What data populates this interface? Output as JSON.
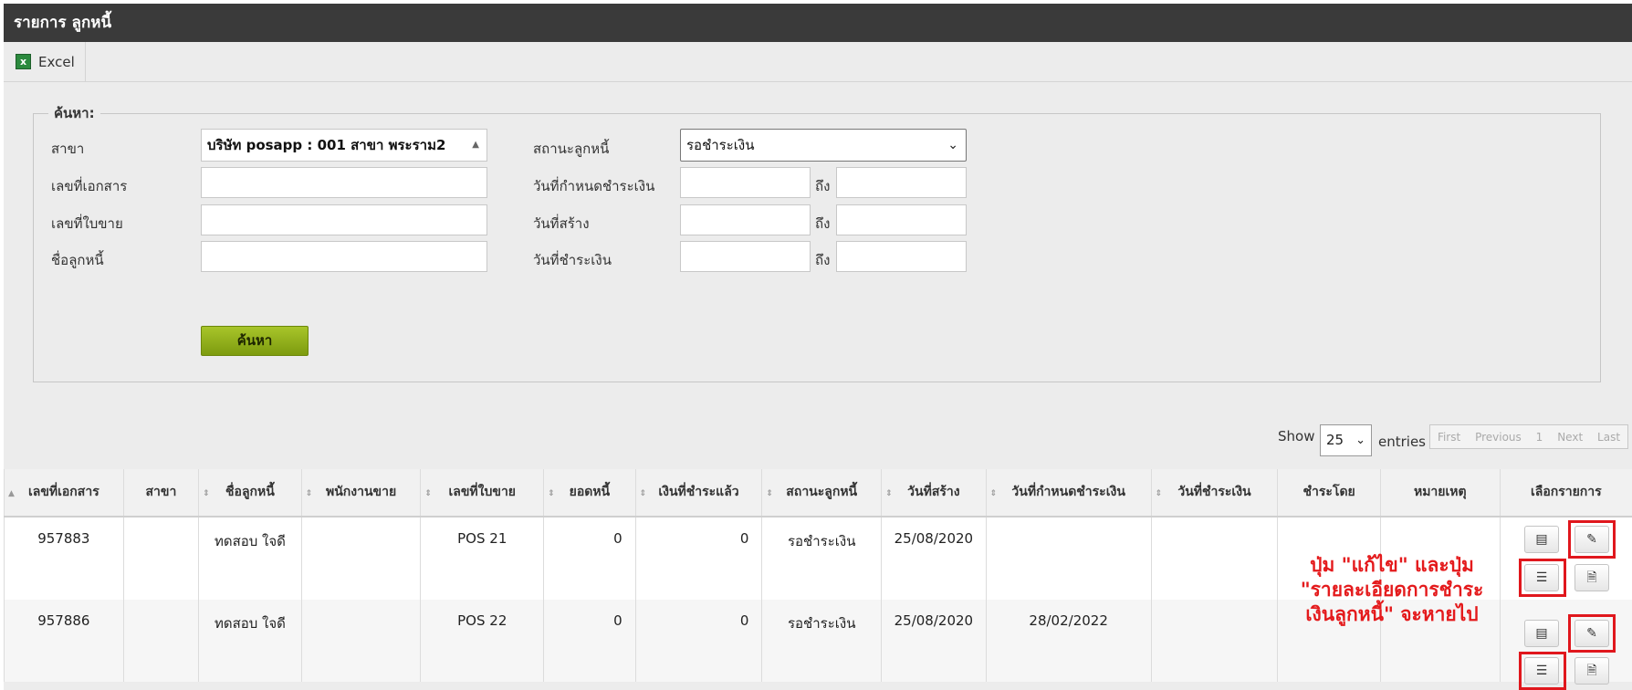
{
  "window": {
    "title": "รายการ ลูกหนี้"
  },
  "toolbar": {
    "excel_label": "Excel"
  },
  "search": {
    "legend": "ค้นหา:",
    "branch_label": "สาขา",
    "branch_value": "บริษัท posapp : 001 สาขา พระราม2",
    "doc_no_label": "เลขที่เอกสาร",
    "invoice_no_label": "เลขที่ใบขาย",
    "debtor_name_label": "ชื่อลูกหนี้",
    "status_label": "สถานะลูกหนี้",
    "status_value": "รอชำระเงิน",
    "due_date_label": "วันที่กำหนดชำระเงิน",
    "created_date_label": "วันที่สร้าง",
    "paid_date_label": "วันที่ชำระเงิน",
    "to_label": "ถึง",
    "button_label": "ค้นหา"
  },
  "paging": {
    "show_label": "Show",
    "page_size": "25",
    "entries_label": "entries",
    "first": "First",
    "previous": "Previous",
    "page": "1",
    "next": "Next",
    "last": "Last"
  },
  "table": {
    "headers": [
      "เลขที่เอกสาร",
      "สาขา",
      "ชื่อลูกหนี้",
      "พนักงานขาย",
      "เลขที่ใบขาย",
      "ยอดหนี้",
      "เงินที่ชำระแล้ว",
      "สถานะลูกหนี้",
      "วันที่สร้าง",
      "วันที่กำหนดชำระเงิน",
      "วันที่ชำระเงิน",
      "ชำระโดย",
      "หมายเหตุ",
      "เลือกรายการ"
    ],
    "rows": [
      {
        "doc_no": "957883",
        "branch": "",
        "debtor": "ทดสอบ ใจดี",
        "salesperson": "",
        "invoice": "POS 21",
        "debt": "0",
        "paid": "0",
        "status": "รอชำระเงิน",
        "created": "25/08/2020",
        "due": "",
        "paid_date": "",
        "paid_by": "",
        "note": ""
      },
      {
        "doc_no": "957886",
        "branch": "",
        "debtor": "ทดสอบ ใจดี",
        "salesperson": "",
        "invoice": "POS 22",
        "debt": "0",
        "paid": "0",
        "status": "รอชำระเงิน",
        "created": "25/08/2020",
        "due": "28/02/2022",
        "paid_date": "",
        "paid_by": "",
        "note": ""
      }
    ]
  },
  "annotation": {
    "line1": "ปุ่ม \"แก้ไข\" และปุ่ม",
    "line2": "\"รายละเอียดการชำระ",
    "line3": "เงินลูกหนี้\" จะหายไป",
    "color": "#e41a1c"
  },
  "icons": [
    "excel-icon",
    "sort-icon",
    "view-icon",
    "edit-icon",
    "list-icon",
    "document-icon",
    "select-caret-icon"
  ]
}
